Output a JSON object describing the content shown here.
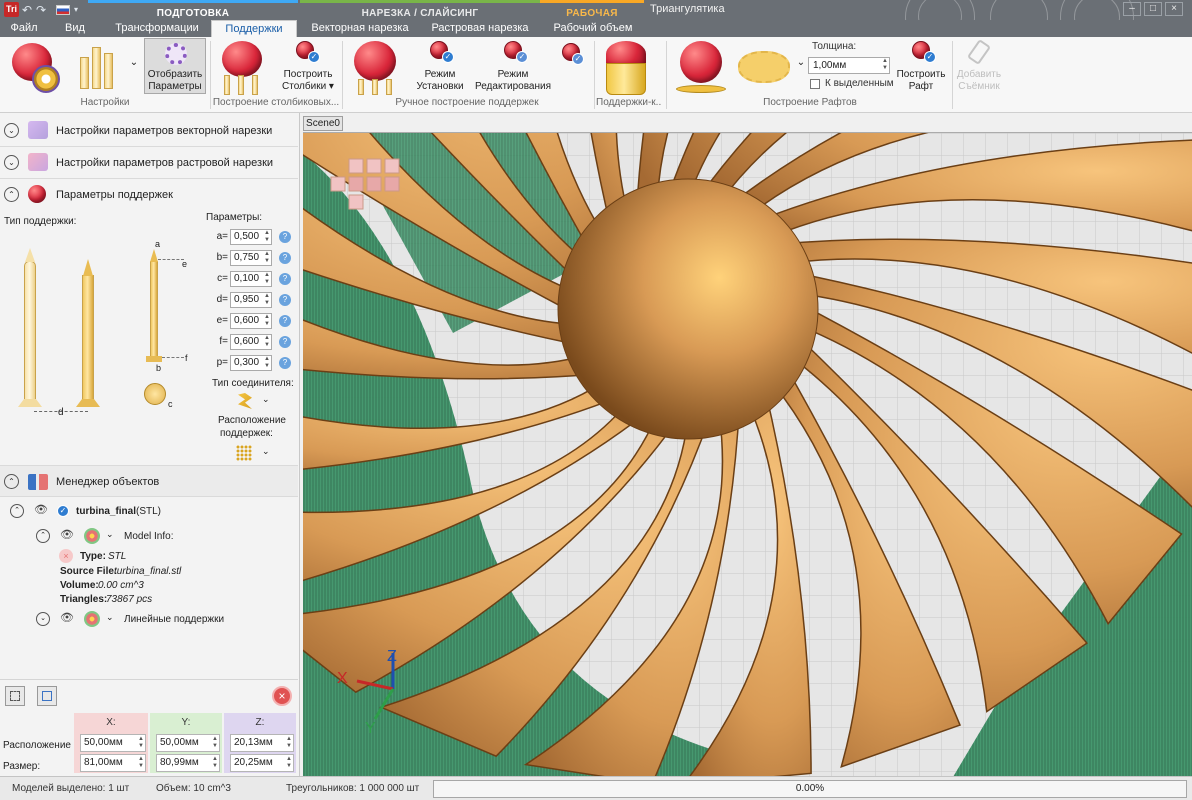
{
  "titlebar": {
    "app_icon": "Tri",
    "window_title": "Триангулятика",
    "groups": {
      "prep": "ПОДГОТОВКА",
      "slicing": "НАРЕЗКА / СЛАЙСИНГ",
      "workspace": "РАБОЧАЯ ОБЛАСТЬ"
    },
    "icons": {
      "undo": "undo-icon",
      "redo": "redo-icon",
      "customize": "quick-access-menu-icon",
      "language": "russian-flag-icon"
    },
    "window_buttons": {
      "minimize": "–",
      "maximize": "□",
      "close": "×"
    }
  },
  "tabs": {
    "file": "Файл",
    "view": "Вид",
    "transform": "Трансформации",
    "supports": "Поддержки",
    "vector": "Векторная нарезка",
    "raster": "Растровая нарезка",
    "work_volume": "Рабочий объем"
  },
  "ribbon": {
    "settings_group": "Настройки",
    "show_params_line1": "Отобразить",
    "show_params_line2": "Параметры",
    "pillar_group": "Построение столбиковых...",
    "build_pillars_line1": "Построить",
    "build_pillars_line2": "Столбики ▾",
    "manual_group": "Ручное построение поддержек",
    "install_mode_line1": "Режим",
    "install_mode_line2": "Установки",
    "edit_mode_line1": "Режим",
    "edit_mode_line2": "Редактирования",
    "supports_k_group": "Поддержки-к...",
    "raft_group": "Построение Рафтов",
    "thickness_label": "Толщина:",
    "thickness_value": "1,00мм",
    "selected_only": "К выделенным",
    "build_raft_line1": "Построить",
    "build_raft_line2": "Рафт",
    "add_removable_line1": "Добавить",
    "add_removable_line2": "Съёмник",
    "dropdown_arrow": "⌄",
    "accent_color": "#1a5ea8"
  },
  "leftpanel": {
    "sections": {
      "vector_settings": "Настройки параметров векторной нарезки",
      "raster_settings": "Настройки параметров растровой нарезки",
      "support_params": "Параметры поддержек",
      "object_manager": "Менеджер объектов"
    },
    "support_type_label": "Тип поддержки:",
    "params_label": "Параметры:",
    "params": [
      {
        "name": "a=",
        "value": "0,500"
      },
      {
        "name": "b=",
        "value": "0,750"
      },
      {
        "name": "c=",
        "value": "0,100"
      },
      {
        "name": "d=",
        "value": "0,950"
      },
      {
        "name": "e=",
        "value": "0,600"
      },
      {
        "name": "f=",
        "value": "0,600"
      },
      {
        "name": "p=",
        "value": "0,300"
      }
    ],
    "diagram_labels": {
      "a": "a",
      "b": "b",
      "c": "c",
      "d": "d",
      "e": "e",
      "f": "f"
    },
    "connector_type_label": "Тип соединителя:",
    "placement_label_line1": "Расположение",
    "placement_label_line2": "поддержек:",
    "help_glyph": "?",
    "tree": {
      "object_name": "turbina_final",
      "object_format": "(STL)",
      "model_info": "Model Info:",
      "type_label": "Type:",
      "type_value": "STL",
      "source_label": "Source File:",
      "source_value": "turbina_final.stl",
      "volume_label": "Volume:",
      "volume_value": "0.00  cm^3",
      "triangles_label": "Triangles:",
      "triangles_value": "73867  pcs",
      "linear_supports": "Линейные поддержки"
    },
    "coords": {
      "x_header": "X:",
      "y_header": "Y:",
      "z_header": "Z:",
      "position_label": "Расположение",
      "size_label": "Размер:",
      "position": [
        "50,00мм",
        "50,00мм",
        "20,13мм"
      ],
      "size": [
        "81,00мм",
        "80,99мм",
        "20,25мм"
      ],
      "x_color": "#f6d6d6",
      "y_color": "#d9efd2",
      "z_color": "#ded6f0"
    }
  },
  "viewport": {
    "scene_tab": "Scene0",
    "axis_x": "X",
    "axis_y": "Y",
    "axis_z": "Z",
    "model_color": "#d89a55",
    "support_color": "#3e9469"
  },
  "status": {
    "models_selected": "Моделей выделено: 1 шт",
    "volume": "Объем: 10 cm^3",
    "triangles": "Треугольников: 1 000 000 шт",
    "progress": "0.00%"
  }
}
